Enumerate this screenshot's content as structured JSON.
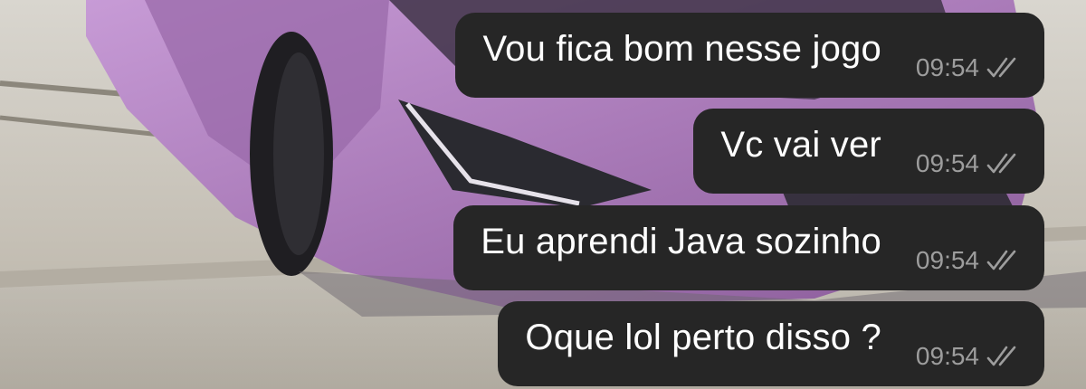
{
  "chat": {
    "colors": {
      "bubble_background": "#262626",
      "message_text": "#ffffff",
      "meta_text": "#9d9d9d",
      "wallpaper_car": "#b58ac4"
    },
    "messages": [
      {
        "text": "Vou fica bom nesse jogo",
        "time": "09:54",
        "status_icon": "double-check-icon"
      },
      {
        "text": "Vc vai ver",
        "time": "09:54",
        "status_icon": "double-check-icon"
      },
      {
        "text": "Eu aprendi Java sozinho",
        "time": "09:54",
        "status_icon": "double-check-icon"
      },
      {
        "text": "Oque lol perto disso ?",
        "time": "09:54",
        "status_icon": "double-check-icon"
      }
    ]
  }
}
